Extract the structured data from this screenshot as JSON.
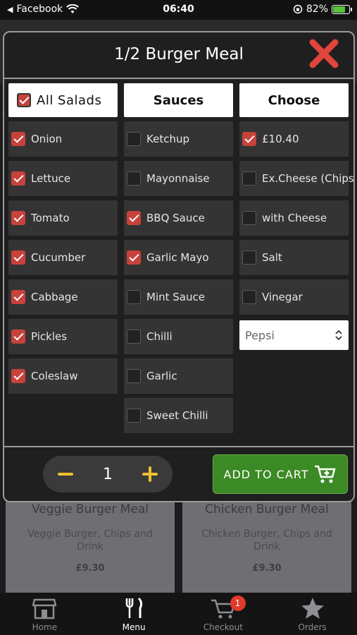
{
  "status_bar": {
    "back_app": "Facebook",
    "time": "06:40",
    "battery": "82%",
    "battery_level": 0.82
  },
  "modal": {
    "title": "1/2 Burger Meal",
    "columns": {
      "salads": {
        "header": "All Salads",
        "header_checked": true,
        "items": [
          {
            "label": "Onion",
            "checked": true
          },
          {
            "label": "Lettuce",
            "checked": true
          },
          {
            "label": "Tomato",
            "checked": true
          },
          {
            "label": "Cucumber",
            "checked": true
          },
          {
            "label": "Cabbage",
            "checked": true
          },
          {
            "label": "Pickles",
            "checked": true
          },
          {
            "label": "Coleslaw",
            "checked": true
          }
        ]
      },
      "sauces": {
        "header": "Sauces",
        "items": [
          {
            "label": "Ketchup",
            "checked": false
          },
          {
            "label": "Mayonnaise",
            "checked": false
          },
          {
            "label": "BBQ Sauce",
            "checked": true
          },
          {
            "label": "Garlic Mayo",
            "checked": true
          },
          {
            "label": "Mint Sauce",
            "checked": false
          },
          {
            "label": "Chilli",
            "checked": false
          },
          {
            "label": "Garlic",
            "checked": false
          },
          {
            "label": "Sweet Chilli",
            "checked": false
          }
        ]
      },
      "choose": {
        "header": "Choose",
        "items": [
          {
            "label": "£10.40",
            "checked": true
          },
          {
            "label": "Ex.Cheese (Chips)",
            "checked": false
          },
          {
            "label": "with Cheese",
            "checked": false
          },
          {
            "label": "Salt",
            "checked": false
          },
          {
            "label": "Vinegar",
            "checked": false
          }
        ],
        "drink_select": "Pepsi"
      }
    },
    "quantity": "1",
    "add_to_cart_label": "ADD TO CART"
  },
  "background_cards": [
    {
      "title": "Veggie Burger Meal",
      "description": "Veggie Burger, Chips and Drink",
      "price": "£9.30"
    },
    {
      "title": "Chicken Burger Meal",
      "description": "Chicken Burger, Chips and Drink",
      "price": "£9.30"
    }
  ],
  "tab_bar": {
    "tabs": [
      {
        "label": "Home",
        "icon": "store-icon"
      },
      {
        "label": "Menu",
        "icon": "fork-knife-icon",
        "active": true
      },
      {
        "label": "Checkout",
        "icon": "cart-icon",
        "badge": "1"
      },
      {
        "label": "Orders",
        "icon": "star-icon"
      }
    ]
  },
  "colors": {
    "accent_red": "#c7423b",
    "cart_green": "#3b8a25",
    "qty_yellow": "#f0c030",
    "badge_red": "#e23a2a"
  }
}
